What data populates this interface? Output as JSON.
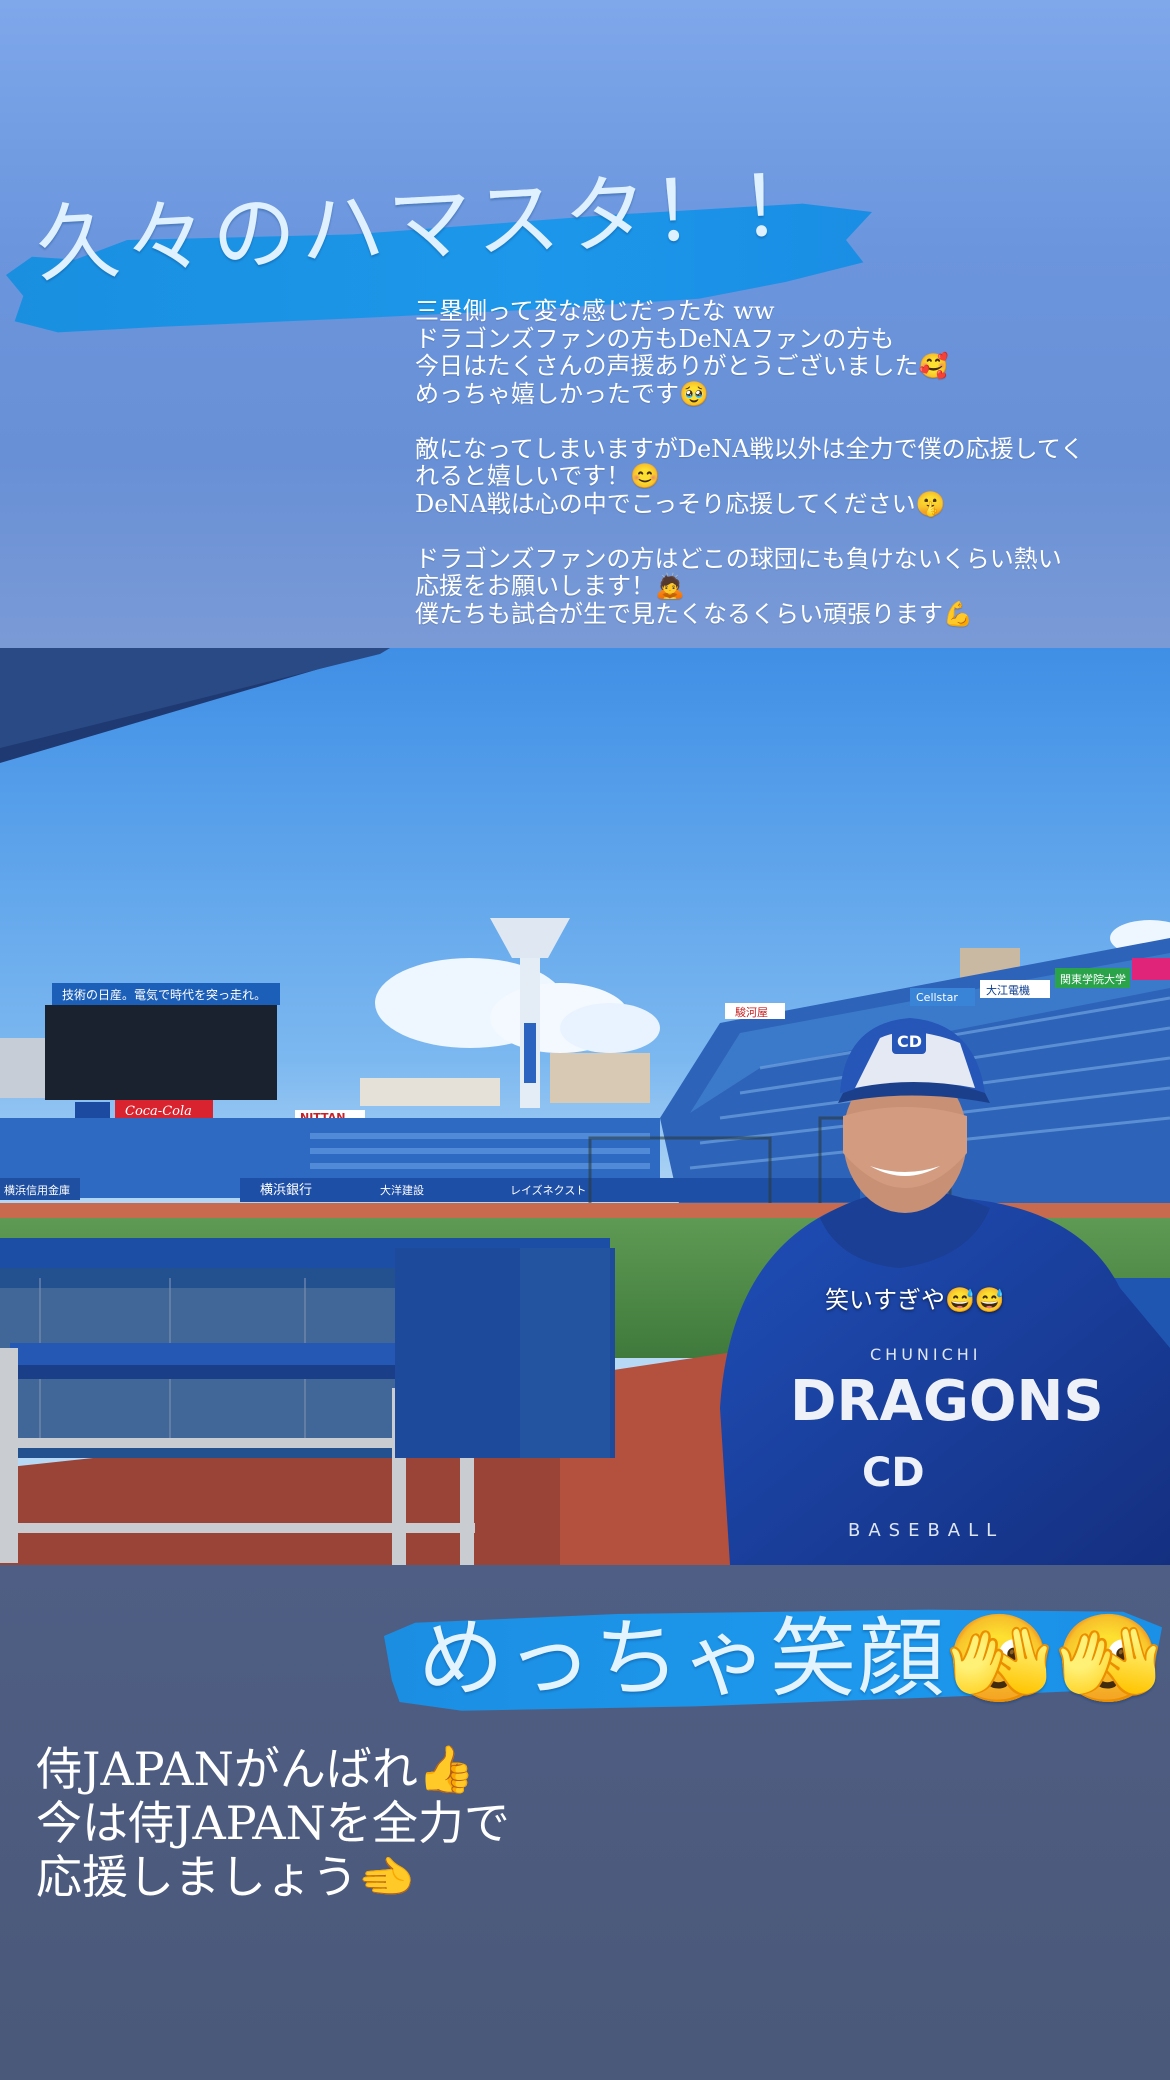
{
  "header": {
    "title": "久々のハマスタ！！"
  },
  "message": {
    "lines": [
      "三塁側って変な感じだったな ww",
      "ドラゴンズファンの方もDeNAファンの方も",
      "今日はたくさんの声援ありがとうございました🥰",
      "めっちゃ嬉しかったです🥹",
      "",
      "敵になってしまいますがDeNA戦以外は全力で僕の応援してく",
      "れると嬉しいです！😊",
      "DeNA戦は心の中でこっそり応援してください🤫",
      "",
      "ドラゴンズファンの方はどこの球団にも負けないくらい熱い",
      "応援をお願いします！🙇",
      "僕たちも試合が生で見たくなるくらい頑張ります💪"
    ]
  },
  "photo": {
    "caption": "笑いすぎや😅😅",
    "stadium_banner": "技術の日産。電気で時代を突っ走れ。",
    "jersey_team": "DRAGONS",
    "jersey_top": "CHUNICHI",
    "jersey_bottom": "BASEBALL",
    "ads": [
      "NITTAN",
      "Coca-Cola",
      "横浜銀行",
      "大洋建設",
      "レイズネクスト",
      "Cellstar",
      "大江電機",
      "関東学院大学",
      "駿河屋",
      "横浜信用金庫"
    ]
  },
  "subtitle": {
    "text": "めっちゃ笑顔🫣🫣"
  },
  "footer": {
    "lines": [
      "侍JAPANがんばれ👍",
      "今は侍JAPANを全力で",
      "応援しましょう🫲"
    ]
  },
  "colors": {
    "sky_top": "#7ea8ea",
    "brush_blue": "#1c97ea",
    "bottom_bg": "#4f5e84"
  }
}
